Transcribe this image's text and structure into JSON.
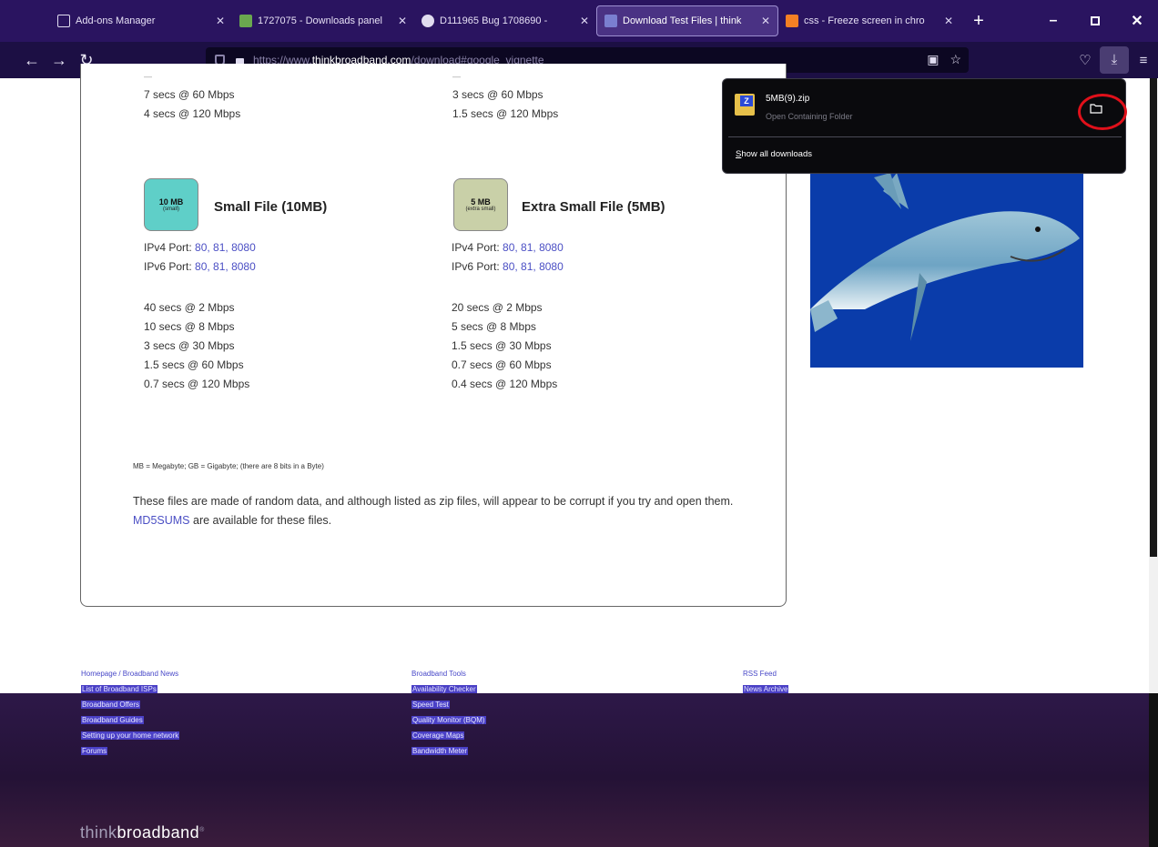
{
  "browser": {
    "tabs": [
      {
        "title": "Add-ons Manager",
        "icon": "puzzle-icon",
        "color": "#e0dcef",
        "active": false
      },
      {
        "title": "1727075 - Downloads panel",
        "icon": "bug-icon",
        "color": "#6aa84f",
        "active": false
      },
      {
        "title": "D111965 Bug 1708690 -",
        "icon": "gear-icon",
        "color": "#e0dcef",
        "active": false
      },
      {
        "title": "Download Test Files | think",
        "icon": "page-icon",
        "color": "#7a7fd0",
        "active": true
      },
      {
        "title": "css - Freeze screen in chro",
        "icon": "stack-icon",
        "color": "#f48024",
        "active": false
      }
    ],
    "url_prefix": "https://www.",
    "url_domain": "thinkbroadband.com",
    "url_suffix": "/download#google_vignette"
  },
  "top_cut": {
    "left": [
      "7 secs @ 60 Mbps",
      "4 secs @ 120 Mbps"
    ],
    "right": [
      "3 secs @ 60 Mbps",
      "1.5 secs @ 120 Mbps"
    ]
  },
  "files": [
    {
      "badge_size": "10 MB",
      "badge_sub": "(small)",
      "badge_color": "#5fcfc8",
      "title": "Small File (10MB)",
      "ipv4_label": "IPv4 Port:",
      "ipv4_ports": "80, 81, 8080",
      "ipv6_label": "IPv6 Port:",
      "ipv6_ports": "80, 81, 8080",
      "times": [
        "40 secs @ 2 Mbps",
        "10 secs @ 8 Mbps",
        "3 secs @ 30 Mbps",
        "1.5 secs @ 60 Mbps",
        "0.7 secs @ 120 Mbps"
      ]
    },
    {
      "badge_size": "5 MB",
      "badge_sub": "(extra small)",
      "badge_color": "#c9d0a8",
      "title": "Extra Small File (5MB)",
      "ipv4_label": "IPv4 Port:",
      "ipv4_ports": "80, 81, 8080",
      "ipv6_label": "IPv6 Port:",
      "ipv6_ports": "80, 81, 8080",
      "times": [
        "20 secs @ 2 Mbps",
        "5 secs @ 8 Mbps",
        "1.5 secs @ 30 Mbps",
        "0.7 secs @ 60 Mbps",
        "0.4 secs @ 120 Mbps"
      ]
    }
  ],
  "note": "MB = Megabyte; GB = Gigabyte; (there are 8 bits in a Byte)",
  "desc": {
    "text1": "These files are made of random data, and although listed as zip files, will appear to be corrupt if you try and open them. ",
    "link": "MD5SUMS",
    "text2": " are available for these files."
  },
  "footer": {
    "col1": [
      "Homepage / Broadband News",
      "List of Broadband ISPs",
      "Broadband Offers",
      "Broadband Guides",
      "Setting up your home network",
      "Forums"
    ],
    "col2": [
      "Broadband Tools",
      "Availability Checker",
      "Speed Test",
      "Quality Monitor (BQM)",
      "Coverage Maps",
      "Bandwidth Meter"
    ],
    "col3": [
      "RSS Feed",
      "News Archive"
    ],
    "logo_light": "think",
    "logo_bold": "broadband"
  },
  "downloads_panel": {
    "file_name": "5MB(9).zip",
    "status": "Open Containing Folder",
    "show_all_prefix": "S",
    "show_all_rest": "how all downloads",
    "highlight_color": "#e0101a"
  }
}
